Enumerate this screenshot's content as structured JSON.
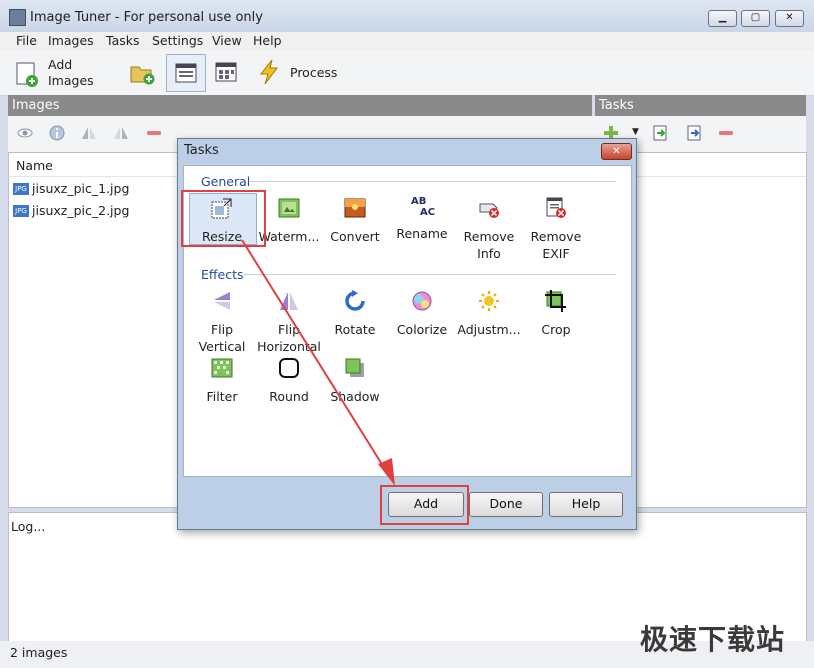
{
  "window": {
    "title": "Image Tuner - For personal use only"
  },
  "menu": [
    "File",
    "Images",
    "Tasks",
    "Settings",
    "View",
    "Help"
  ],
  "toolbar": {
    "add_images_line1": "Add",
    "add_images_line2": "Images",
    "process": "Process"
  },
  "panels": {
    "images_header": "Images",
    "tasks_header": "Tasks"
  },
  "files": {
    "column_name": "Name",
    "items": [
      "jisuxz_pic_1.jpg",
      "jisuxz_pic_2.jpg"
    ],
    "file_badge": "JPG"
  },
  "log": {
    "text": "Log..."
  },
  "status": {
    "text": "2 images"
  },
  "dialog": {
    "title": "Tasks",
    "close_glyph": "✕",
    "general_label": "General",
    "general": [
      {
        "label": "Resize",
        "sub": ""
      },
      {
        "label": "Waterm...",
        "sub": ""
      },
      {
        "label": "Convert",
        "sub": ""
      },
      {
        "label": "Rename",
        "sub": ""
      },
      {
        "label": "Remove",
        "sub": "Info"
      },
      {
        "label": "Remove",
        "sub": "EXIF"
      }
    ],
    "effects_label": "Effects",
    "effects": [
      {
        "label": "Flip",
        "sub": "Vertical"
      },
      {
        "label": "Flip",
        "sub": "Horizontal"
      },
      {
        "label": "Rotate",
        "sub": ""
      },
      {
        "label": "Colorize",
        "sub": ""
      },
      {
        "label": "Adjustm...",
        "sub": ""
      },
      {
        "label": "Crop",
        "sub": ""
      },
      {
        "label": "Filter",
        "sub": ""
      },
      {
        "label": "Round",
        "sub": ""
      },
      {
        "label": "Shadow",
        "sub": ""
      }
    ],
    "buttons": {
      "add": "Add",
      "done": "Done",
      "help": "Help"
    },
    "rename_glyph_top": "AB",
    "rename_glyph_bottom": "AC"
  },
  "watermark": "极速下载站",
  "colors": {
    "accent_red": "#e23f3f",
    "header_gray": "#8a8a8a",
    "dialog_frame": "#bccfe6"
  }
}
